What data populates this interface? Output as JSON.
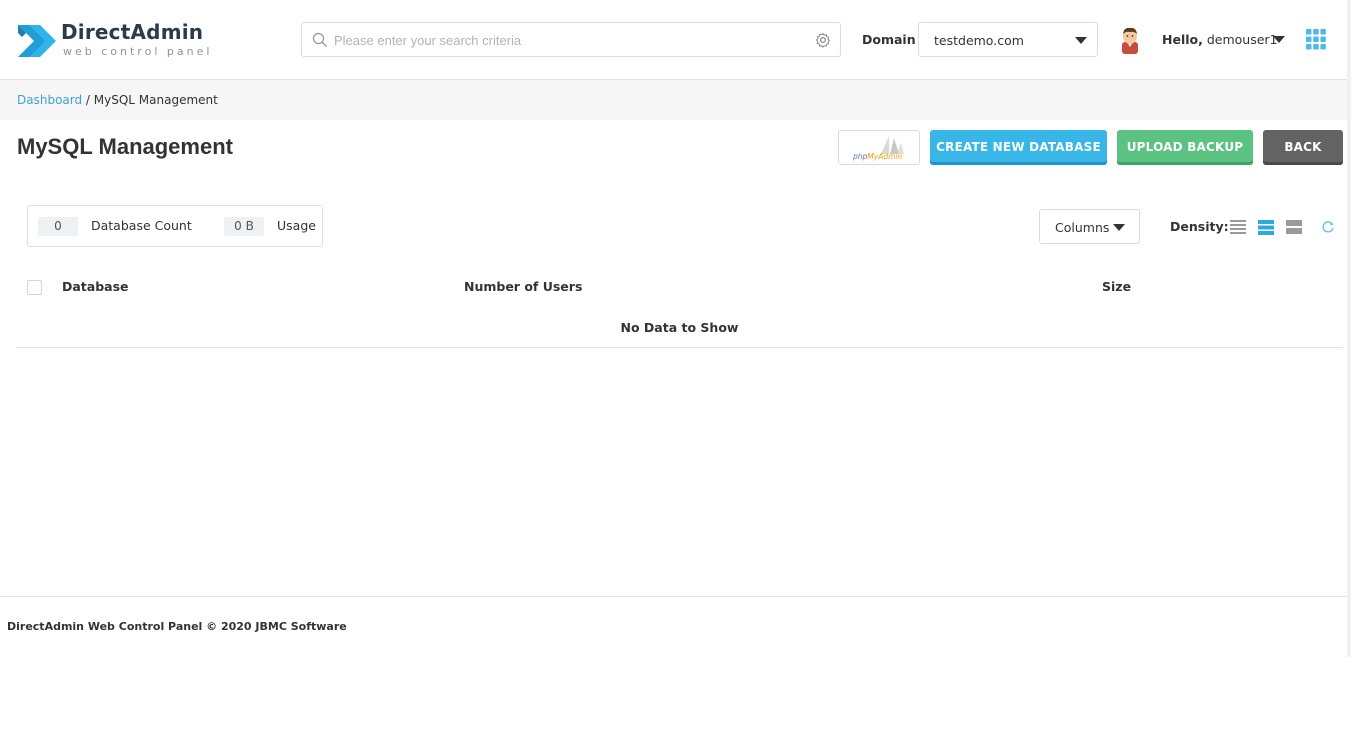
{
  "header": {
    "logo_title": "DirectAdmin",
    "logo_subtitle": "web control panel",
    "search_placeholder": "Please enter your search criteria",
    "domain_label": "Domain",
    "domain_value": "testdemo.com",
    "greeting": "Hello,",
    "username": "demouser1"
  },
  "breadcrumb": {
    "home": "Dashboard",
    "separator": " / ",
    "current": "MySQL Management"
  },
  "main": {
    "title": "MySQL Management",
    "phpmyadmin": {
      "php": "php",
      "my": "MyAdmin"
    },
    "buttons": {
      "create": "CREATE NEW DATABASE",
      "upload": "UPLOAD BACKUP",
      "back": "BACK"
    },
    "stats": {
      "db_count_value": "0",
      "db_count_label": "Database Count",
      "usage_value": "0 B",
      "usage_label": "Usage"
    },
    "columns_label": "Columns",
    "density_label": "Density:",
    "table": {
      "headers": [
        "Database",
        "Number of Users",
        "Size"
      ],
      "empty_text": "No Data to Show"
    }
  },
  "footer": {
    "text": "DirectAdmin Web Control Panel © 2020 JBMC Software"
  },
  "colors": {
    "accent_blue": "#38b6e8",
    "accent_green": "#5cc282",
    "back_gray": "#636363",
    "link": "#3aa3d8"
  }
}
